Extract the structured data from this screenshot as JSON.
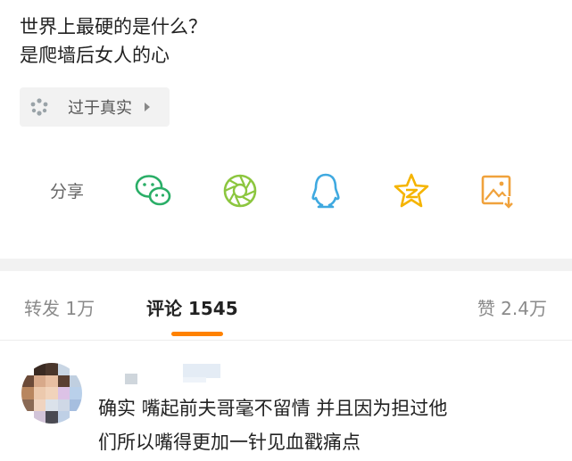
{
  "post": {
    "line1": "世界上最硬的是什么？",
    "line2": "是爬墙后女人的心"
  },
  "topic": {
    "label": "过于真实",
    "icon": "sparkle-dots-icon"
  },
  "share": {
    "label": "分享",
    "icons": [
      "wechat-icon",
      "moments-icon",
      "qq-icon",
      "qzone-icon",
      "save-image-icon"
    ],
    "colors": {
      "wechat": "#2aae67",
      "moments": "#8cc63f",
      "qq": "#3fa9e0",
      "qzone": "#f5b400",
      "save": "#f0a23c"
    }
  },
  "tabs": {
    "repost": "转发 1万",
    "comments": "评论 1545",
    "likes": "赞 2.4万",
    "accent": "#ff8200"
  },
  "comment": {
    "line1": "确实 嘴起前夫哥毫不留情 并且因为担过他",
    "line2": "们所以嘴得更加一针见血戳痛点"
  }
}
